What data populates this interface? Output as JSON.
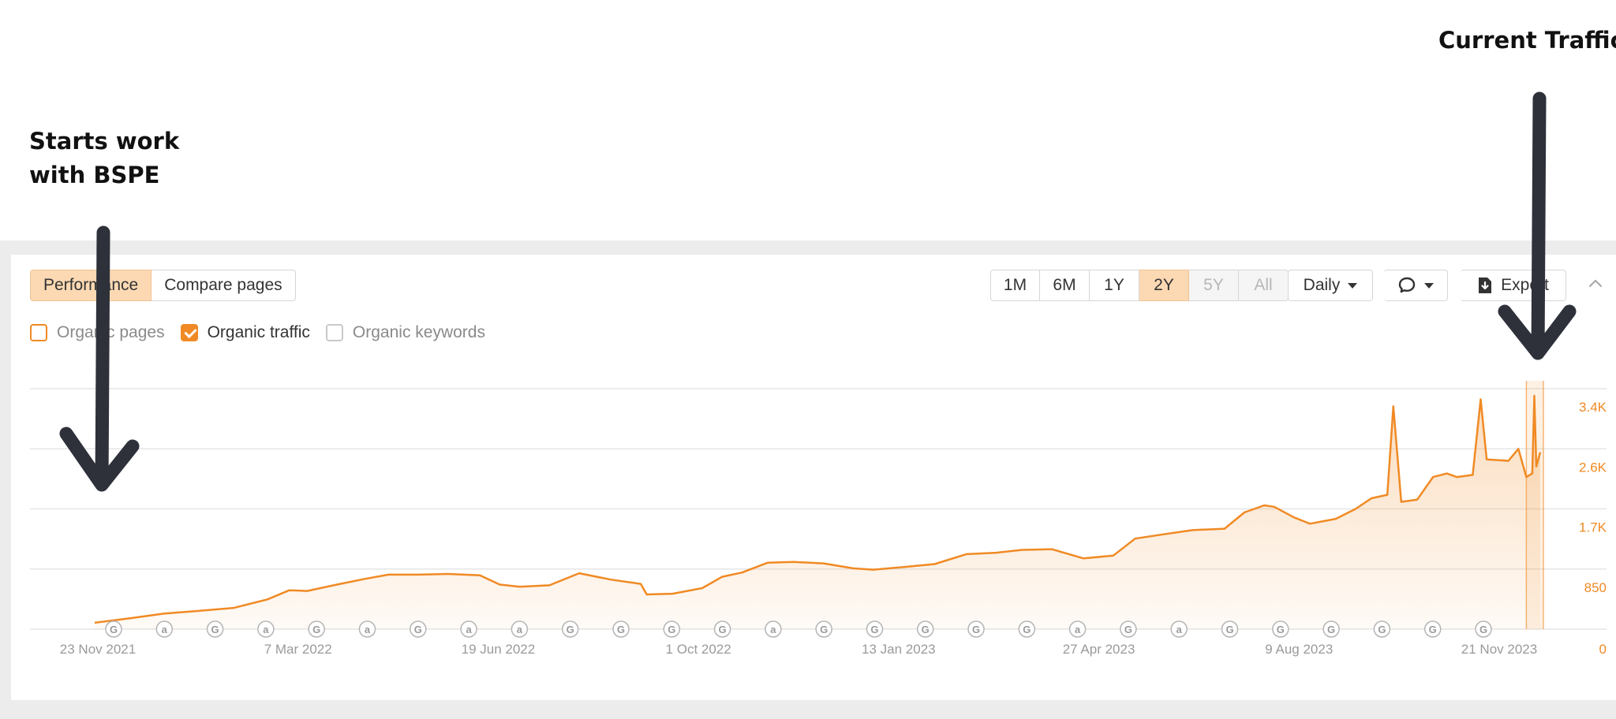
{
  "annotations": {
    "left_line1": "Starts work",
    "left_line2": "with BSPE",
    "right": "Current Traffic"
  },
  "tabs": [
    {
      "label": "Performance",
      "active": true
    },
    {
      "label": "Compare pages",
      "active": false
    }
  ],
  "ranges": [
    {
      "label": "1M",
      "state": "normal"
    },
    {
      "label": "6M",
      "state": "normal"
    },
    {
      "label": "1Y",
      "state": "normal"
    },
    {
      "label": "2Y",
      "state": "active"
    },
    {
      "label": "5Y",
      "state": "disabled"
    },
    {
      "label": "All",
      "state": "disabled"
    }
  ],
  "interval_label": "Daily",
  "export_label": "Export",
  "icons": {
    "comment": "comment-icon",
    "export": "download-icon",
    "collapse": "chevron-up-icon",
    "dropdown": "caret-down-icon"
  },
  "legend": [
    {
      "label": "Organic pages",
      "state": "unchecked",
      "color": "#f08a24"
    },
    {
      "label": "Organic traffic",
      "state": "checked",
      "color": "#f08a24"
    },
    {
      "label": "Organic keywords",
      "state": "unchecked",
      "color": "#c9c9c9"
    }
  ],
  "colors": {
    "accent": "#f08a24",
    "active_bg": "#fcd9b3",
    "arrow": "#2e313a"
  },
  "chart_data": {
    "type": "area",
    "title": "",
    "xlabel": "",
    "ylabel": "",
    "x_ticks": [
      "23 Nov 2021",
      "7 Mar 2022",
      "19 Jun 2022",
      "1 Oct 2022",
      "13 Jan 2023",
      "27 Apr 2023",
      "9 Aug 2023",
      "21 Nov 2023"
    ],
    "y_ticks": [
      0,
      850,
      1700,
      2550,
      3400
    ],
    "y_tick_labels": [
      "0",
      "850",
      "1.7K",
      "2.6K",
      "3.4K"
    ],
    "ylim": [
      0,
      3400
    ],
    "xlim": [
      "2021-11-23",
      "2023-11-21"
    ],
    "grid": true,
    "series": [
      {
        "name": "Organic traffic",
        "points": [
          [
            "2021-11-23",
            90
          ],
          [
            "2021-12-10",
            150
          ],
          [
            "2021-12-28",
            220
          ],
          [
            "2022-01-15",
            260
          ],
          [
            "2022-02-01",
            300
          ],
          [
            "2022-02-18",
            420
          ],
          [
            "2022-03-01",
            550
          ],
          [
            "2022-03-10",
            540
          ],
          [
            "2022-03-25",
            630
          ],
          [
            "2022-04-08",
            710
          ],
          [
            "2022-04-20",
            770
          ],
          [
            "2022-05-05",
            770
          ],
          [
            "2022-05-20",
            780
          ],
          [
            "2022-06-05",
            760
          ],
          [
            "2022-06-15",
            630
          ],
          [
            "2022-06-25",
            600
          ],
          [
            "2022-07-10",
            620
          ],
          [
            "2022-07-25",
            790
          ],
          [
            "2022-08-10",
            700
          ],
          [
            "2022-08-25",
            640
          ],
          [
            "2022-08-28",
            490
          ],
          [
            "2022-09-10",
            500
          ],
          [
            "2022-09-25",
            580
          ],
          [
            "2022-10-05",
            740
          ],
          [
            "2022-10-15",
            800
          ],
          [
            "2022-10-28",
            940
          ],
          [
            "2022-11-10",
            950
          ],
          [
            "2022-11-25",
            930
          ],
          [
            "2022-12-10",
            860
          ],
          [
            "2022-12-20",
            840
          ],
          [
            "2023-01-05",
            880
          ],
          [
            "2023-01-20",
            920
          ],
          [
            "2023-02-05",
            1060
          ],
          [
            "2023-02-20",
            1080
          ],
          [
            "2023-03-05",
            1120
          ],
          [
            "2023-03-20",
            1130
          ],
          [
            "2023-04-05",
            1000
          ],
          [
            "2023-04-20",
            1040
          ],
          [
            "2023-05-01",
            1280
          ],
          [
            "2023-05-15",
            1340
          ],
          [
            "2023-05-30",
            1400
          ],
          [
            "2023-06-15",
            1420
          ],
          [
            "2023-06-25",
            1650
          ],
          [
            "2023-07-05",
            1750
          ],
          [
            "2023-07-10",
            1730
          ],
          [
            "2023-07-20",
            1580
          ],
          [
            "2023-07-28",
            1490
          ],
          [
            "2023-08-10",
            1560
          ],
          [
            "2023-08-20",
            1700
          ],
          [
            "2023-08-28",
            1850
          ],
          [
            "2023-09-05",
            1900
          ],
          [
            "2023-09-08",
            3150
          ],
          [
            "2023-09-12",
            1800
          ],
          [
            "2023-09-20",
            1830
          ],
          [
            "2023-09-28",
            2150
          ],
          [
            "2023-10-05",
            2200
          ],
          [
            "2023-10-10",
            2150
          ],
          [
            "2023-10-18",
            2180
          ],
          [
            "2023-10-22",
            3250
          ],
          [
            "2023-10-25",
            2400
          ],
          [
            "2023-11-05",
            2380
          ],
          [
            "2023-11-10",
            2550
          ],
          [
            "2023-11-14",
            2150
          ],
          [
            "2023-11-17",
            2200
          ],
          [
            "2023-11-18",
            3300
          ],
          [
            "2023-11-19",
            2300
          ],
          [
            "2023-11-21",
            2500
          ]
        ]
      }
    ],
    "markers": [
      "G",
      "a",
      "G",
      "a",
      "G",
      "a",
      "G",
      "a",
      "a",
      "G",
      "G",
      "G",
      "G",
      "a",
      "G",
      "G",
      "G",
      "G",
      "G",
      "a",
      "G",
      "a",
      "G",
      "G",
      "G",
      "G",
      "G",
      "G"
    ]
  }
}
